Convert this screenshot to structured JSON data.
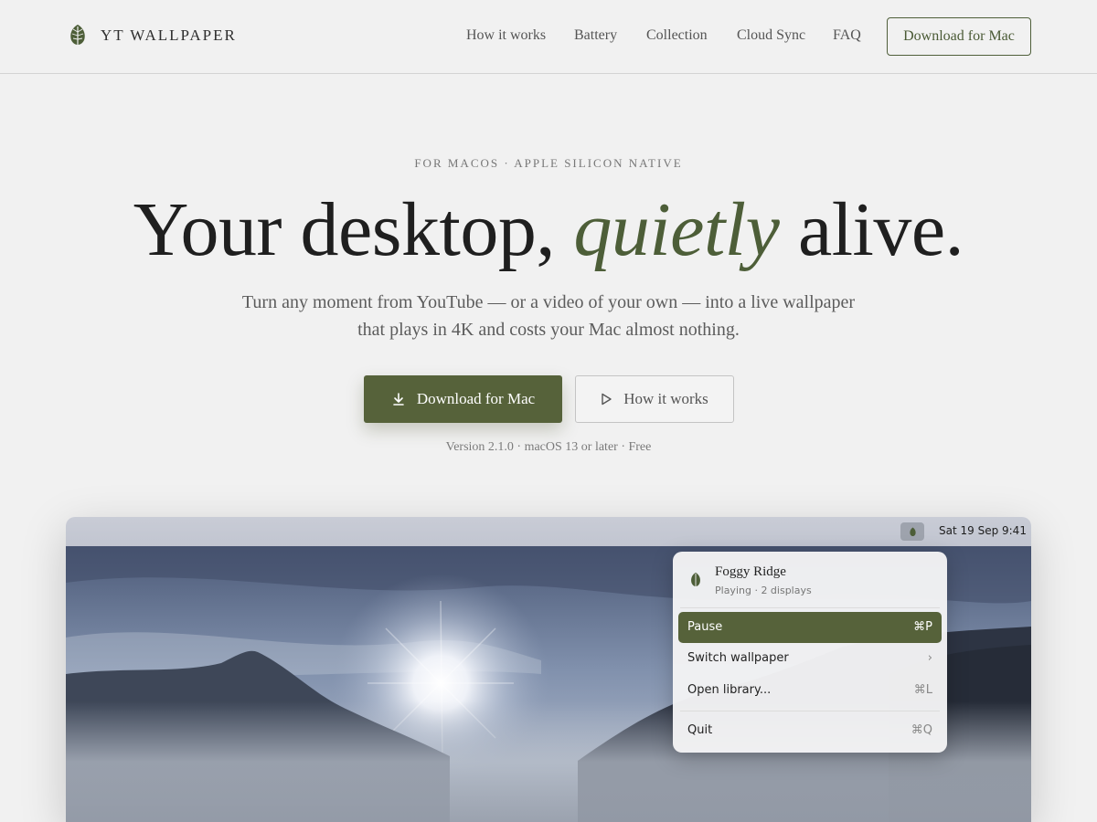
{
  "header": {
    "brand_name": "YT WALLPAPER",
    "nav": [
      {
        "label": "How it works"
      },
      {
        "label": "Battery"
      },
      {
        "label": "Collection"
      },
      {
        "label": "Cloud Sync"
      },
      {
        "label": "FAQ"
      }
    ],
    "cta_label": "Download for Mac"
  },
  "hero": {
    "eyebrow": "FOR MACOS · APPLE SILICON NATIVE",
    "headline_before": "Your desktop, ",
    "headline_accent": "quietly",
    "headline_after": " alive.",
    "subhead": "Turn any moment from YouTube — or a video of your own — into a live wallpaper that plays in 4K and costs your Mac almost nothing.",
    "primary_button": "Download for Mac",
    "secondary_button": "How it works",
    "version_line": "Version 2.1.0 · macOS 13 or later · Free"
  },
  "preview": {
    "menubar_time": "Sat 19 Sep 9:41",
    "menu": {
      "title": "Foggy Ridge",
      "subtitle": "Playing · 2 displays",
      "items": [
        {
          "label": "Pause",
          "shortcut": "⌘P"
        },
        {
          "label": "Switch wallpaper",
          "shortcut": "›"
        },
        {
          "label": "Open library...",
          "shortcut": "⌘L"
        },
        {
          "label": "Quit",
          "shortcut": "⌘Q"
        }
      ]
    }
  },
  "colors": {
    "accent": "#56623a",
    "background": "#f1f1f1",
    "text": "#1f1f1f"
  },
  "icons": [
    "leaf-logo-icon",
    "download-icon",
    "play-icon",
    "menubar-leaf-icon"
  ]
}
